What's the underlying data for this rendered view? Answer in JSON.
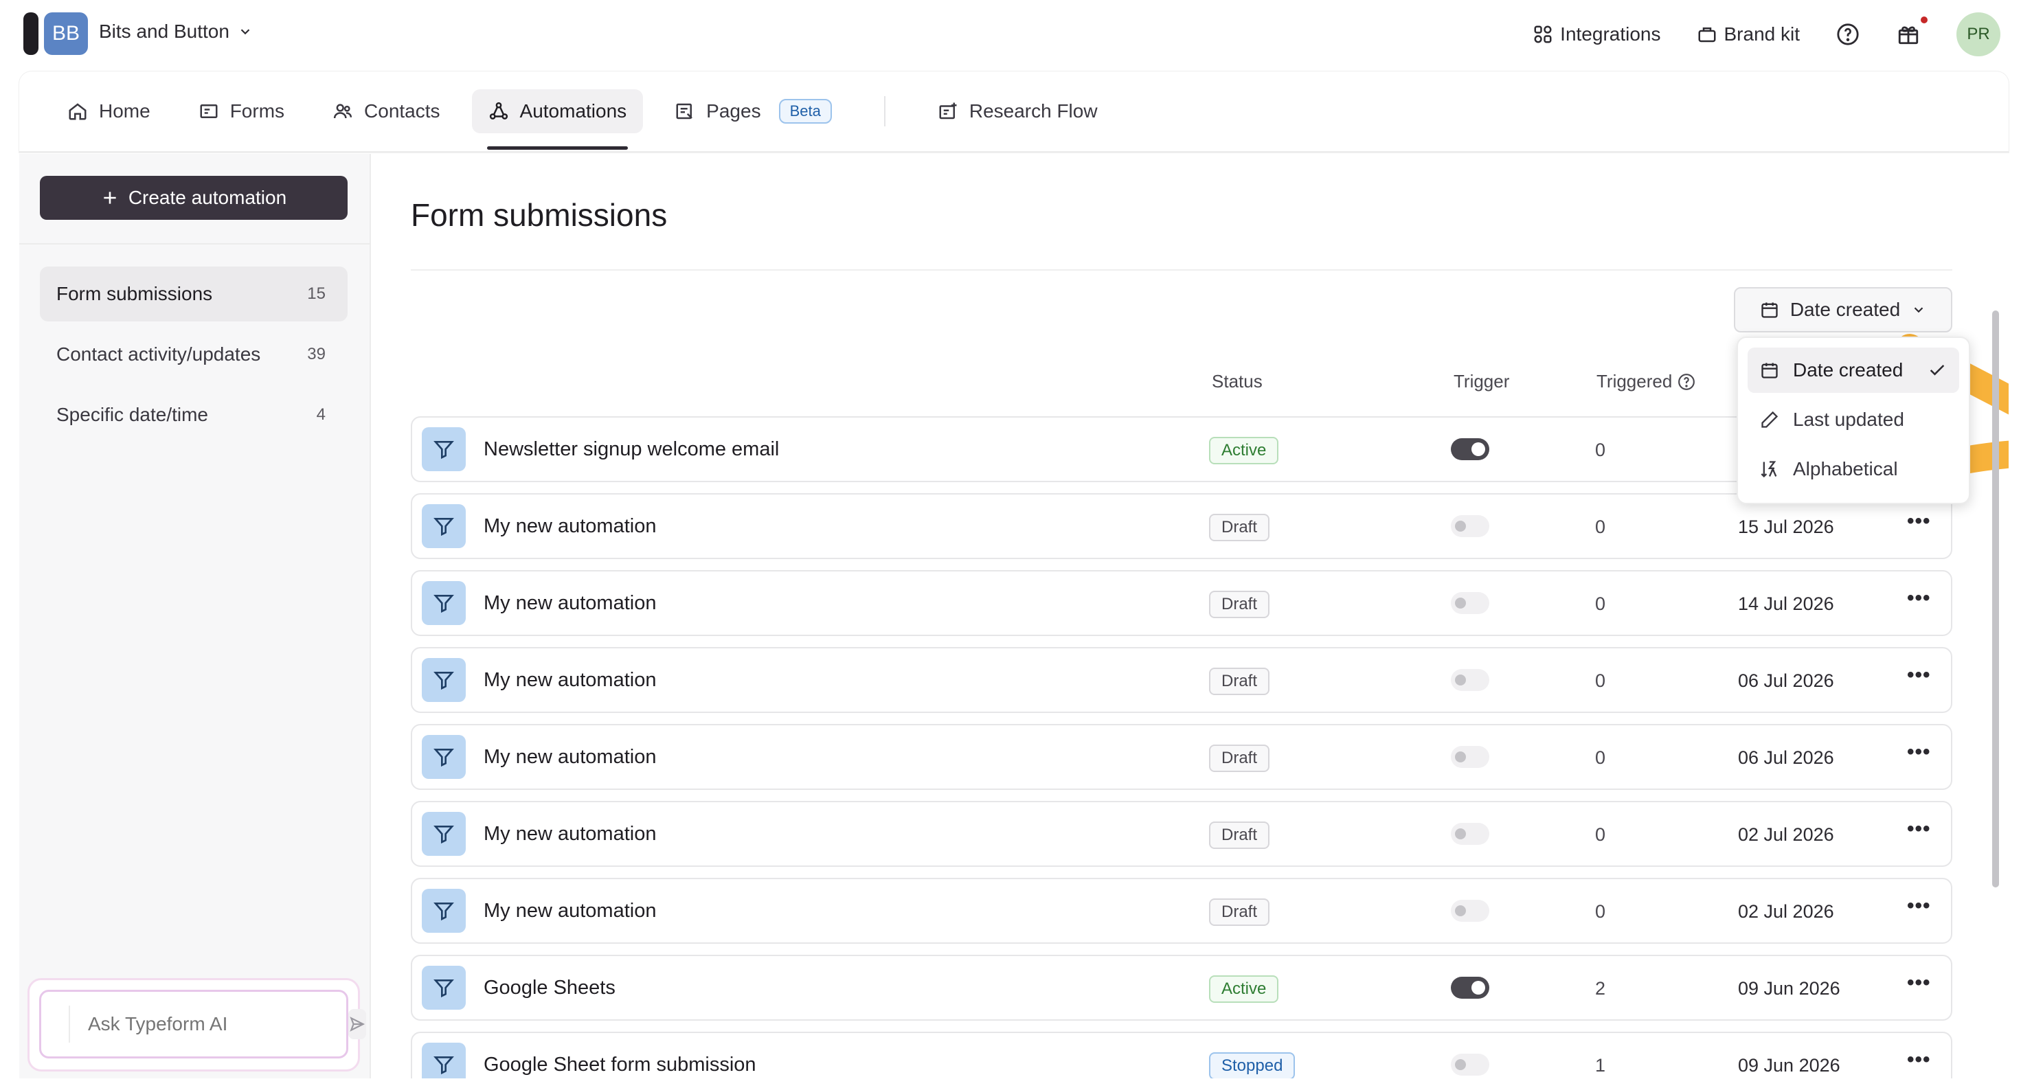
{
  "workspace": {
    "initials": "BB",
    "name": "Bits and Button"
  },
  "topbar": {
    "integrations_label": "Integrations",
    "brand_kit_label": "Brand kit",
    "avatar_initials": "PR"
  },
  "nav": {
    "items": [
      {
        "label": "Home",
        "icon": "home-icon"
      },
      {
        "label": "Forms",
        "icon": "forms-icon"
      },
      {
        "label": "Contacts",
        "icon": "contacts-icon"
      },
      {
        "label": "Automations",
        "icon": "automations-icon",
        "active": true
      },
      {
        "label": "Pages",
        "icon": "pages-icon",
        "badge": "Beta"
      }
    ],
    "research_flow_label": "Research Flow"
  },
  "sidebar": {
    "create_label": "Create automation",
    "items": [
      {
        "label": "Form submissions",
        "count": "15",
        "active": true
      },
      {
        "label": "Contact activity/updates",
        "count": "39"
      },
      {
        "label": "Specific date/time",
        "count": "4"
      }
    ],
    "ai_placeholder": "Ask Typeform AI"
  },
  "main": {
    "title": "Form submissions",
    "sort_label": "Date created",
    "columns": {
      "status": "Status",
      "trigger": "Trigger",
      "triggered": "Triggered"
    }
  },
  "sort_menu": [
    {
      "label": "Date created",
      "icon": "calendar-icon",
      "selected": true
    },
    {
      "label": "Last updated",
      "icon": "pencil-icon"
    },
    {
      "label": "Alphabetical",
      "icon": "sort-az-icon"
    }
  ],
  "rows": [
    {
      "name": "Newsletter signup welcome email",
      "status": "Active",
      "trigger_on": true,
      "triggered": "0",
      "date": ""
    },
    {
      "name": "My new automation",
      "status": "Draft",
      "trigger_on": false,
      "triggered": "0",
      "date": "15 Jul 2026"
    },
    {
      "name": "My new automation",
      "status": "Draft",
      "trigger_on": false,
      "triggered": "0",
      "date": "14 Jul 2026"
    },
    {
      "name": "My new automation",
      "status": "Draft",
      "trigger_on": false,
      "triggered": "0",
      "date": "06 Jul 2026"
    },
    {
      "name": "My new automation",
      "status": "Draft",
      "trigger_on": false,
      "triggered": "0",
      "date": "06 Jul 2026"
    },
    {
      "name": "My new automation",
      "status": "Draft",
      "trigger_on": false,
      "triggered": "0",
      "date": "02 Jul 2026"
    },
    {
      "name": "My new automation",
      "status": "Draft",
      "trigger_on": false,
      "triggered": "0",
      "date": "02 Jul 2026"
    },
    {
      "name": "Google Sheets",
      "status": "Active",
      "trigger_on": true,
      "triggered": "2",
      "date": "09 Jun 2026"
    },
    {
      "name": "Google Sheet form submission",
      "status": "Stopped",
      "trigger_on": false,
      "triggered": "1",
      "date": "09 Jun 2026"
    }
  ],
  "colors": {
    "accent_arrow": "#f7b23b",
    "create_button": "#3a343f",
    "row_icon_bg": "#bcd7f3"
  }
}
